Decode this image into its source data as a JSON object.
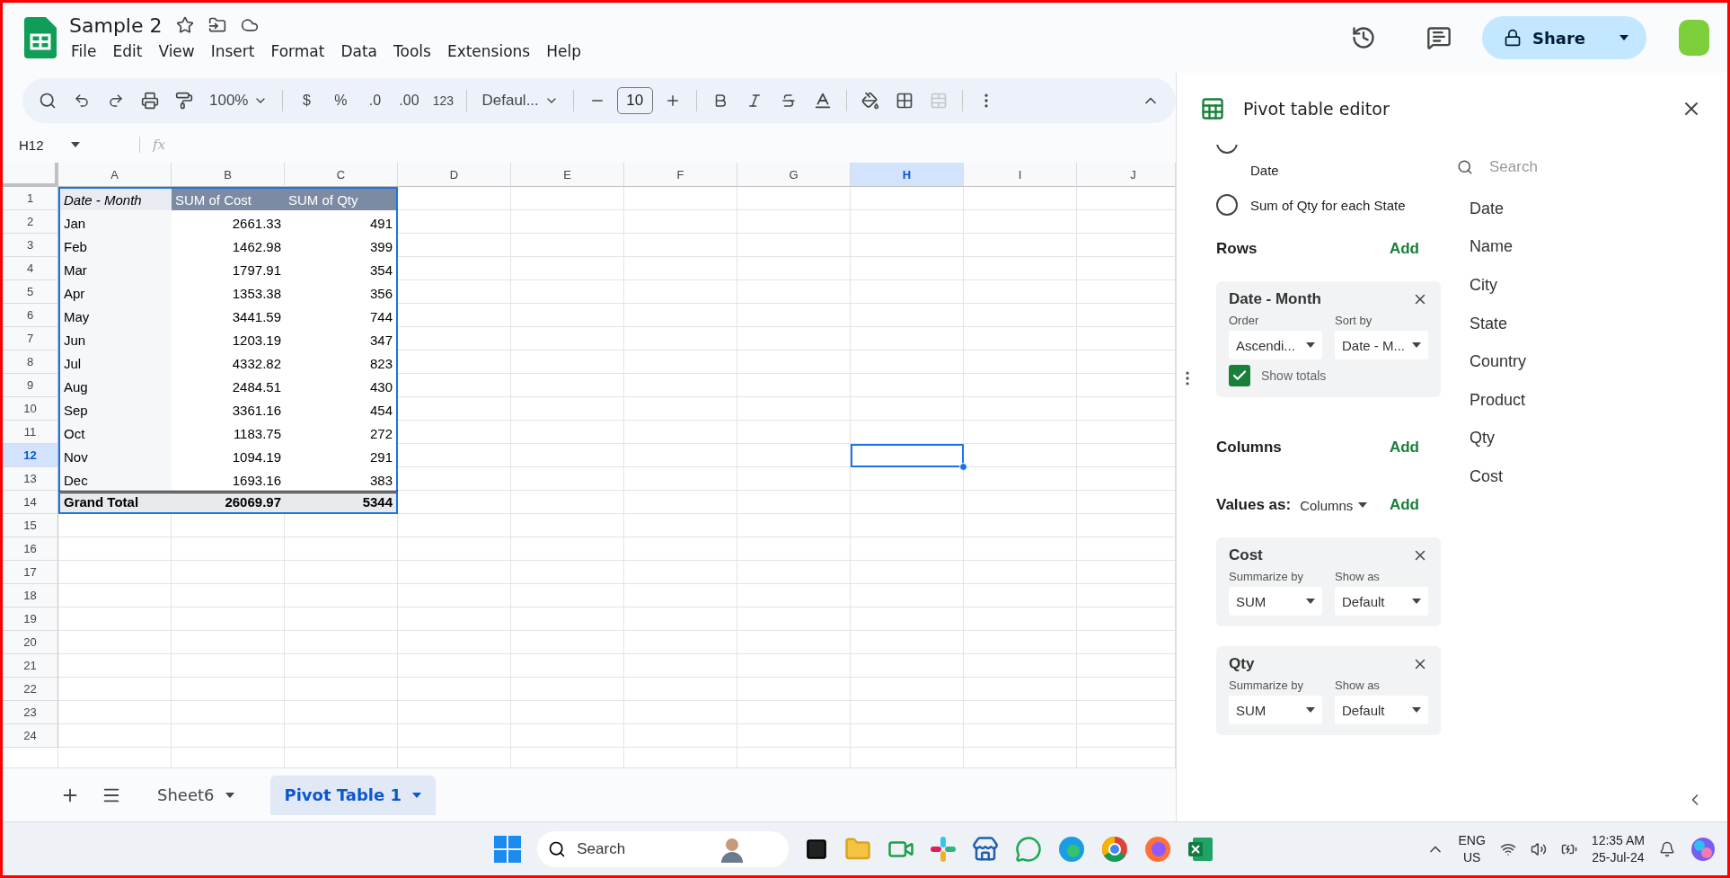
{
  "document": {
    "title": "Sample 2",
    "menu": [
      "File",
      "Edit",
      "View",
      "Insert",
      "Format",
      "Data",
      "Tools",
      "Extensions",
      "Help"
    ],
    "share": "Share"
  },
  "toolbar": {
    "zoom": "100%",
    "currency": "$",
    "percent": "%",
    "decrease_decimals": ".0",
    "increase_decimals": ".00",
    "number_format": "123",
    "font": "Defaul...",
    "font_size": "10"
  },
  "formula_bar": {
    "cell_ref": "H12",
    "fx": "fx"
  },
  "grid": {
    "columns": [
      {
        "label": "A",
        "selected": false
      },
      {
        "label": "B",
        "selected": false
      },
      {
        "label": "C",
        "selected": false
      },
      {
        "label": "D",
        "selected": false
      },
      {
        "label": "E",
        "selected": false
      },
      {
        "label": "F",
        "selected": false
      },
      {
        "label": "G",
        "selected": false
      },
      {
        "label": "H",
        "selected": true
      },
      {
        "label": "I",
        "selected": false
      },
      {
        "label": "J",
        "selected": false
      }
    ],
    "rows": [
      {
        "label": "1",
        "selected": false
      },
      {
        "label": "2",
        "selected": false
      },
      {
        "label": "3",
        "selected": false
      },
      {
        "label": "4",
        "selected": false
      },
      {
        "label": "5",
        "selected": false
      },
      {
        "label": "6",
        "selected": false
      },
      {
        "label": "7",
        "selected": false
      },
      {
        "label": "8",
        "selected": false
      },
      {
        "label": "9",
        "selected": false
      },
      {
        "label": "10",
        "selected": false
      },
      {
        "label": "11",
        "selected": false
      },
      {
        "label": "12",
        "selected": true
      },
      {
        "label": "13",
        "selected": false
      },
      {
        "label": "14",
        "selected": false
      },
      {
        "label": "15",
        "selected": false
      },
      {
        "label": "16",
        "selected": false
      },
      {
        "label": "17",
        "selected": false
      },
      {
        "label": "18",
        "selected": false
      },
      {
        "label": "19",
        "selected": false
      },
      {
        "label": "20",
        "selected": false
      },
      {
        "label": "21",
        "selected": false
      },
      {
        "label": "22",
        "selected": false
      },
      {
        "label": "23",
        "selected": false
      },
      {
        "label": "24",
        "selected": false
      }
    ],
    "pivot": {
      "header": [
        "Date - Month",
        "SUM of Cost",
        "SUM of Qty"
      ],
      "rows": [
        [
          "Jan",
          "2661.33",
          "491"
        ],
        [
          "Feb",
          "1462.98",
          "399"
        ],
        [
          "Mar",
          "1797.91",
          "354"
        ],
        [
          "Apr",
          "1353.38",
          "356"
        ],
        [
          "May",
          "3441.59",
          "744"
        ],
        [
          "Jun",
          "1203.19",
          "347"
        ],
        [
          "Jul",
          "4332.82",
          "823"
        ],
        [
          "Aug",
          "2484.51",
          "430"
        ],
        [
          "Sep",
          "3361.16",
          "454"
        ],
        [
          "Oct",
          "1183.75",
          "272"
        ],
        [
          "Nov",
          "1094.19",
          "291"
        ],
        [
          "Dec",
          "1693.16",
          "383"
        ]
      ],
      "total": [
        "Grand Total",
        "26069.97",
        "5344"
      ]
    }
  },
  "pivot_editor": {
    "title": "Pivot table editor",
    "suggestions": [
      {
        "label": "Date",
        "selected": false
      },
      {
        "label": "Sum of Qty for each State",
        "selected": false
      }
    ],
    "rows": {
      "label": "Rows",
      "add": "Add",
      "cards": [
        {
          "title": "Date - Month",
          "fields": [
            {
              "label": "Order",
              "value": "Ascendi..."
            },
            {
              "label": "Sort by",
              "value": "Date - M..."
            }
          ],
          "show_totals": {
            "label": "Show totals",
            "checked": true
          }
        }
      ]
    },
    "columns": {
      "label": "Columns",
      "add": "Add"
    },
    "values": {
      "label": "Values as:",
      "mode": "Columns",
      "add": "Add",
      "cards": [
        {
          "title": "Cost",
          "fields": [
            {
              "label": "Summarize by",
              "value": "SUM"
            },
            {
              "label": "Show as",
              "value": "Default"
            }
          ]
        },
        {
          "title": "Qty",
          "fields": [
            {
              "label": "Summarize by",
              "value": "SUM"
            },
            {
              "label": "Show as",
              "value": "Default"
            }
          ]
        }
      ]
    },
    "field_search": {
      "placeholder": "Search"
    },
    "fields": [
      "Date",
      "Name",
      "City",
      "State",
      "Country",
      "Product",
      "Qty",
      "Cost"
    ]
  },
  "sheet_tabs": [
    {
      "label": "Sheet6",
      "selected": false
    },
    {
      "label": "Pivot Table 1",
      "selected": true
    }
  ],
  "taskbar": {
    "search_placeholder": "Search",
    "language": "ENG",
    "region": "US",
    "time": "12:35 AM",
    "date": "25-Jul-24"
  }
}
